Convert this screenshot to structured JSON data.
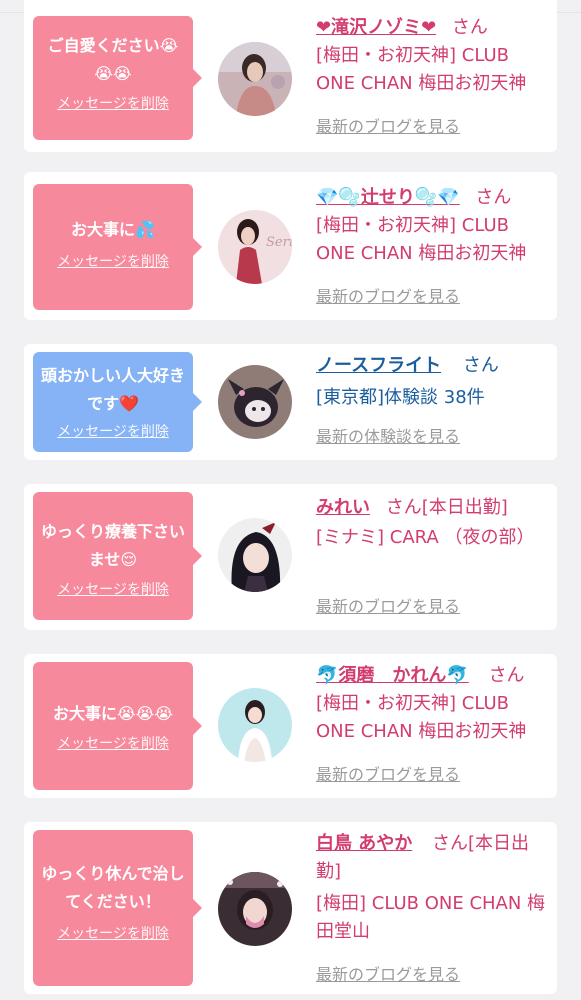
{
  "feed": [
    {
      "color": "pink",
      "message": "ご自愛ください😭😭😭",
      "delete_label": "メッセージを削除",
      "name": "❤滝沢ノゾミ❤",
      "honorific": "さん",
      "shop": "[梅田・お初天神] CLUB ONE CHAN 梅田お初天神",
      "link": "最新のブログを見る"
    },
    {
      "color": "pink",
      "message": "お大事に💦",
      "delete_label": "メッセージを削除",
      "name": "💎🫧辻せり🫧💎",
      "honorific": "さん",
      "shop": "[梅田・お初天神] CLUB ONE CHAN 梅田お初天神",
      "link": "最新のブログを見る"
    },
    {
      "color": "blue",
      "message": "頭おかしい人大好きです❤️",
      "delete_label": "メッセージを削除",
      "name": "ノースフライト",
      "honorific": "さん",
      "shop": "[東京都]体験談 38件",
      "link": "最新の体験談を見る"
    },
    {
      "color": "pink",
      "message": "ゆっくり療養下さいませ😌",
      "delete_label": "メッセージを削除",
      "name": "みれい",
      "honorific": "さん[本日出勤]",
      "shop": "[ミナミ] CARA （夜の部）",
      "link": "最新のブログを見る"
    },
    {
      "color": "pink",
      "message": "お大事に😭😭😭",
      "delete_label": "メッセージを削除",
      "name": "🐬須磨　かれん🐬",
      "honorific": "さん",
      "shop": "[梅田・お初天神] CLUB ONE CHAN 梅田お初天神",
      "link": "最新のブログを見る"
    },
    {
      "color": "pink",
      "message": "ゆっくり休んで治してください！",
      "delete_label": "メッセージを削除",
      "name": "白鳥 あやか",
      "honorific": "さん[本日出勤]",
      "shop": "[梅田] CLUB ONE CHAN 梅田堂山",
      "link": "最新のブログを見る"
    }
  ],
  "colors": {
    "pink_bubble": "#f7899d",
    "blue_bubble": "#86b3f6",
    "name_pink": "#d23d6e",
    "name_blue": "#1b5e9e",
    "link_gray": "#9a9a9a"
  },
  "icons": [
    "avatar-photo"
  ]
}
